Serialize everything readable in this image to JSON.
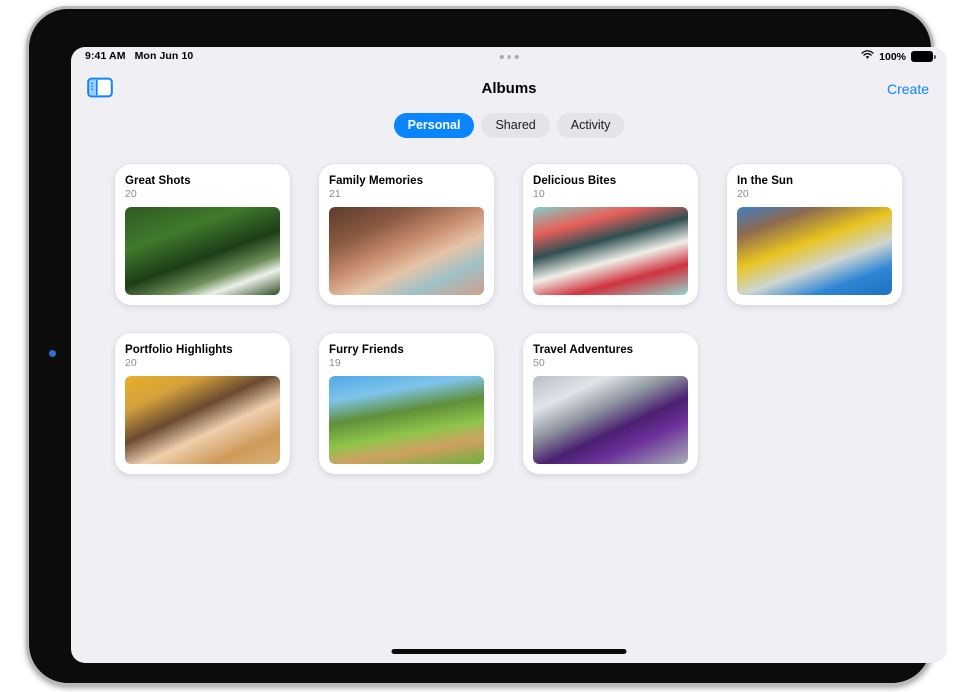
{
  "status_bar": {
    "time": "9:41 AM",
    "date": "Mon Jun 10",
    "battery_percent": "100%",
    "wifi_icon": "wifi-icon",
    "battery_icon": "battery-full-icon",
    "multitask_icon": "multitasking-dots-icon"
  },
  "nav": {
    "sidebar_toggle_icon": "sidebar-toggle-icon",
    "title": "Albums",
    "create_label": "Create"
  },
  "segments": [
    {
      "label": "Personal",
      "active": true
    },
    {
      "label": "Shared",
      "active": false
    },
    {
      "label": "Activity",
      "active": false
    }
  ],
  "colors": {
    "accent": "#0a84ff",
    "screen_background": "#f0eff4",
    "card_background": "#ffffff",
    "segment_inactive": "#e4e3e9",
    "count_text": "#8b8b90"
  },
  "albums": [
    {
      "title": "Great Shots",
      "count": "20",
      "main_photo": "woman-in-green-foliage",
      "thumbs": [
        "person-in-yellow-raincoat",
        "man-with-basketball",
        "person-in-purple-over-city",
        "cat-leaping-blue-sky"
      ],
      "main_style": "linear-gradient(160deg,#2e5a22 0%,#3f7a2c 30%,#1d3d17 55%,#6f8f5a 72%,#eef0ea 82%,#2a4f20 100%)",
      "thumb_styles": [
        "linear-gradient(150deg,#dfe4e7 0%,#f1c40d 42%,#f6d53b 62%,#2a2a2a 78%,#d9dde0 100%)",
        "linear-gradient(165deg,#5e7e95 0%,#8c7a63 35%,#7d3a28 60%,#a8672f 80%,#4a5a64 100%)",
        "linear-gradient(150deg,#cfd6dc 0%,#9aa7b2 30%,#4d2170 58%,#6f3a9e 74%,#d5dade 100%)",
        "linear-gradient(170deg,#1a7de0 0%,#2f93f0 40%,#b98a4a 58%,#8d6334 70%,#1f86e6 100%)"
      ]
    },
    {
      "title": "Family Memories",
      "count": "21",
      "main_photo": "three-children-smiling",
      "thumbs": [
        "parent-and-child-hugging",
        "family-embracing",
        "family-group-indoors",
        "child-in-blue-sweater"
      ],
      "main_style": "linear-gradient(155deg,#5d3a2c 0%,#8a5a43 26%,#c98e6f 46%,#e6c4a8 62%,#9ec2c6 78%,#cf9f8e 100%)",
      "thumb_styles": [
        "linear-gradient(150deg,#b08a72 0%,#dcb49a 30%,#e2a6a0 55%,#cf8f84 75%,#9a7b66 100%)",
        "linear-gradient(160deg,#6b4536 0%,#a07059 35%,#cfa98d 55%,#a9c5c0 78%,#7c5242 100%)",
        "linear-gradient(150deg,#4a3327 0%,#7d5b45 30%,#c9a88e 52%,#6e4a38 75%,#3d2a20 100%)",
        "linear-gradient(155deg,#bda88e 0%,#e2d24a 22%,#9d7a5c 45%,#2f5fa8 66%,#7a5a44 100%)"
      ]
    },
    {
      "title": "Delicious Bites",
      "count": "10",
      "main_photo": "watermelon-bowl-and-raspberries",
      "thumbs": [
        "layered-cake-slice",
        "raspberries-in-cup",
        "pizza-margherita",
        "green-popsicle"
      ],
      "main_style": "linear-gradient(165deg,#7fcfc6 0%,#e8605a 22%,#2f4f52 40%,#efefe8 58%,#cf3340 76%,#8fd6cd 100%)",
      "thumb_styles": [
        "linear-gradient(150deg,#a07aa8 0%,#efe6e2 32%,#d44a62 52%,#6e3340 72%,#b489b8 100%)",
        "linear-gradient(155deg,#c9a0b5 0%,#e8dfe2 25%,#cf3347 55%,#a8808f 78%,#d4b0c0 100%)",
        "linear-gradient(150deg,#2f9fd4 0%,#c9582f 30%,#efe2cf 52%,#8fae4a 72%,#3fa8dc 100%)",
        "linear-gradient(170deg,#9fb4c4 0%,#7fc93a 28%,#5da82a 55%,#cfa870 78%,#8fa8bc 100%)"
      ]
    },
    {
      "title": "In the Sun",
      "count": "20",
      "main_photo": "friends-huddle-from-below",
      "thumbs": [
        "person-lying-on-grass",
        "friends-playing-ball",
        "group-in-field",
        "person-reaching-up"
      ],
      "main_style": "linear-gradient(160deg,#3f7fc4 0%,#8d6a50 20%,#e8c320 42%,#cfd6d2 62%,#2f86d4 80%,#1f6fc0 100%)",
      "thumb_styles": [
        "linear-gradient(170deg,#2f86d8 0%,#4f9ae4 38%,#e8c320 58%,#4f8a3a 78%,#3f8a4a 100%)",
        "linear-gradient(155deg,#2f86d8 0%,#d4562a 20%,#e8c320 44%,#cfd8de 66%,#2f7fd0 100%)",
        "linear-gradient(160deg,#3f8fdc 0%,#e8c320 30%,#d8dde0 52%,#7a8a94 72%,#4f96e0 100%)",
        "linear-gradient(165deg,#2f86d8 0%,#e8c320 28%,#dfe4e6 48%,#4f8a3a 74%,#3f8fd8 100%)"
      ]
    },
    {
      "title": "Portfolio Highlights",
      "count": "20",
      "main_photo": "woman-lying-on-patterned-bed",
      "thumbs": [
        "person-in-dark-doorway",
        "palm-tree-and-sky",
        "dancer-in-yellow-dress",
        "clouds-over-field"
      ],
      "main_style": "linear-gradient(155deg,#e8b028 0%,#d4a03c 22%,#6b4a30 42%,#efcfae 60%,#cf9a5a 80%,#d8b070 100%)",
      "thumb_styles": [
        "linear-gradient(160deg,#1c1410 0%,#3a2a20 35%,#8f2f3a 55%,#2a1e18 78%,#161210 100%)",
        "linear-gradient(165deg,#8fc4e4 0%,#4f8a3a 30%,#2f6a28 52%,#a8cfe8 74%,#6fae9a 100%)",
        "linear-gradient(155deg,#e8c320 0%,#d4a420 30%,#2f5a8a 55%,#efd44a 76%,#c99a18 100%)",
        "linear-gradient(170deg,#2f6fae 0%,#cfd8e2 28%,#8fa8bc 50%,#4f7a3a 76%,#2f5a8a 100%)"
      ]
    },
    {
      "title": "Furry Friends",
      "count": "19",
      "main_photo": "golden-retriever-running-in-field",
      "thumbs": [
        "dog-with-person-on-grass",
        "dog-howling-at-sky",
        "dog-sitting-in-grass",
        "horse-close-up"
      ],
      "main_style": "linear-gradient(170deg,#4fa8e4 0%,#7fc4ea 22%,#5f8f3a 42%,#8fc44a 62%,#cfa060 78%,#6fae3a 100%)",
      "thumb_styles": [
        "linear-gradient(160deg,#5f9f3a 0%,#cfa870 28%,#e8e4df 50%,#6faf3a 74%,#4f8a2a 100%)",
        "linear-gradient(165deg,#4fa4e4 0%,#8fc9ee 30%,#c9934a 55%,#8fae3a 78%,#5fa8e0 100%)",
        "linear-gradient(160deg,#4fa4e4 0%,#5f8f3a 30%,#cf9a4a 55%,#7fb83a 76%,#4f8a2a 100%)",
        "linear-gradient(155deg,#6fb0e4 0%,#8f5a30 28%,#c98f5a 52%,#efe8e0 72%,#7a4a28 100%)"
      ]
    },
    {
      "title": "Travel Adventures",
      "count": "50",
      "main_photo": "city-skyline-from-below-purple-fabric",
      "thumbs": [
        "person-in-yellow-on-stairs",
        "person-climbing-yellow",
        "figure-on-city-street",
        "dancers-on-rooftop"
      ],
      "main_style": "linear-gradient(155deg,#b9c0c6 0%,#dfe4e8 22%,#8f96a0 40%,#4a2070 58%,#6b2f9a 72%,#a8b0b8 100%)",
      "thumb_styles": [
        "linear-gradient(150deg,#cfd6dc 0%,#e8c320 38%,#d4a810 58%,#2a2a2a 76%,#bfc6cc 100%)",
        "linear-gradient(155deg,#dfe4e8 0%,#aab2ba 28%,#e8c320 55%,#2f5a8a 76%,#cfd6dc 100%)",
        "linear-gradient(160deg,#9fb0bc 0%,#5f6a74 30%,#cfd8e0 52%,#2a3a46 74%,#8fa0ac 100%)",
        "linear-gradient(165deg,#4fa4e4 0%,#cfd8e0 26%,#2a2a3a 52%,#8f96a0 72%,#3f96dc 100%)"
      ]
    }
  ],
  "home_indicator": "home-indicator"
}
